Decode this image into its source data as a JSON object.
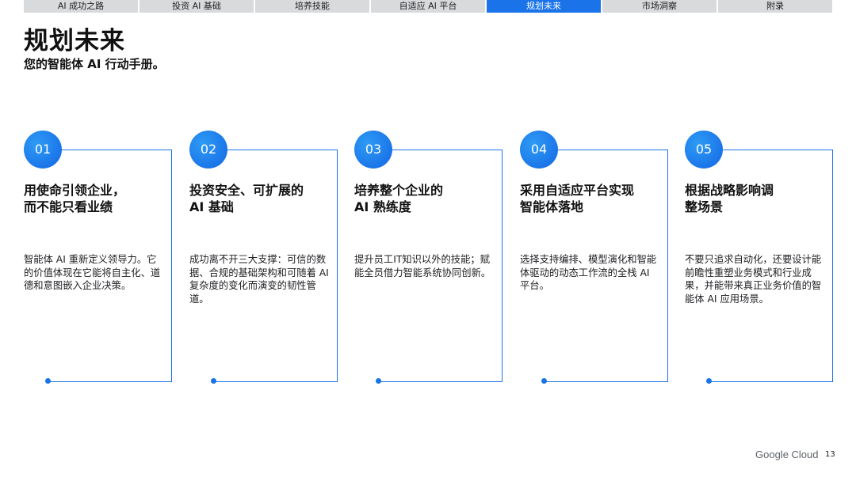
{
  "nav": {
    "tabs": [
      {
        "label": "AI 成功之路",
        "active": false
      },
      {
        "label": "投资 AI 基础",
        "active": false
      },
      {
        "label": "培养技能",
        "active": false
      },
      {
        "label": "自适应 AI 平台",
        "active": false
      },
      {
        "label": "规划未来",
        "active": true
      },
      {
        "label": "市场洞察",
        "active": false
      },
      {
        "label": "附录",
        "active": false
      }
    ]
  },
  "page": {
    "title": "规划未来",
    "subtitle": "您的智能体 AI 行动手册。"
  },
  "cards": [
    {
      "number": "01",
      "heading": "用使命引领企业，\n而不能只看业绩",
      "body": "智能体 AI 重新定义领导力。它的价值体现在它能将自主化、道德和意图嵌入企业决策。"
    },
    {
      "number": "02",
      "heading": "投资安全、可扩展的\nAI 基础",
      "body": "成功离不开三大支撑：可信的数据、合规的基础架构和可随着 AI 复杂度的变化而演变的韧性管道。"
    },
    {
      "number": "03",
      "heading": "培养整个企业的\nAI 熟练度",
      "body": "提升员工IT知识以外的技能；赋能全员借力智能系统协同创新。"
    },
    {
      "number": "04",
      "heading": "采用自适应平台实现\n智能体落地",
      "body": "选择支持编排、模型演化和智能体驱动的动态工作流的全栈 AI 平台。"
    },
    {
      "number": "05",
      "heading": "根据战略影响调\n整场景",
      "body": "不要只追求自动化，还要设计能前瞻性重塑业务模式和行业成果，并能带来真正业务价值的智能体 AI 应用场景。"
    }
  ],
  "footer": {
    "brand": "Google Cloud",
    "page_number": "13"
  },
  "colors": {
    "accent": "#1a73e8",
    "tab_inactive": "#d9dadc"
  }
}
